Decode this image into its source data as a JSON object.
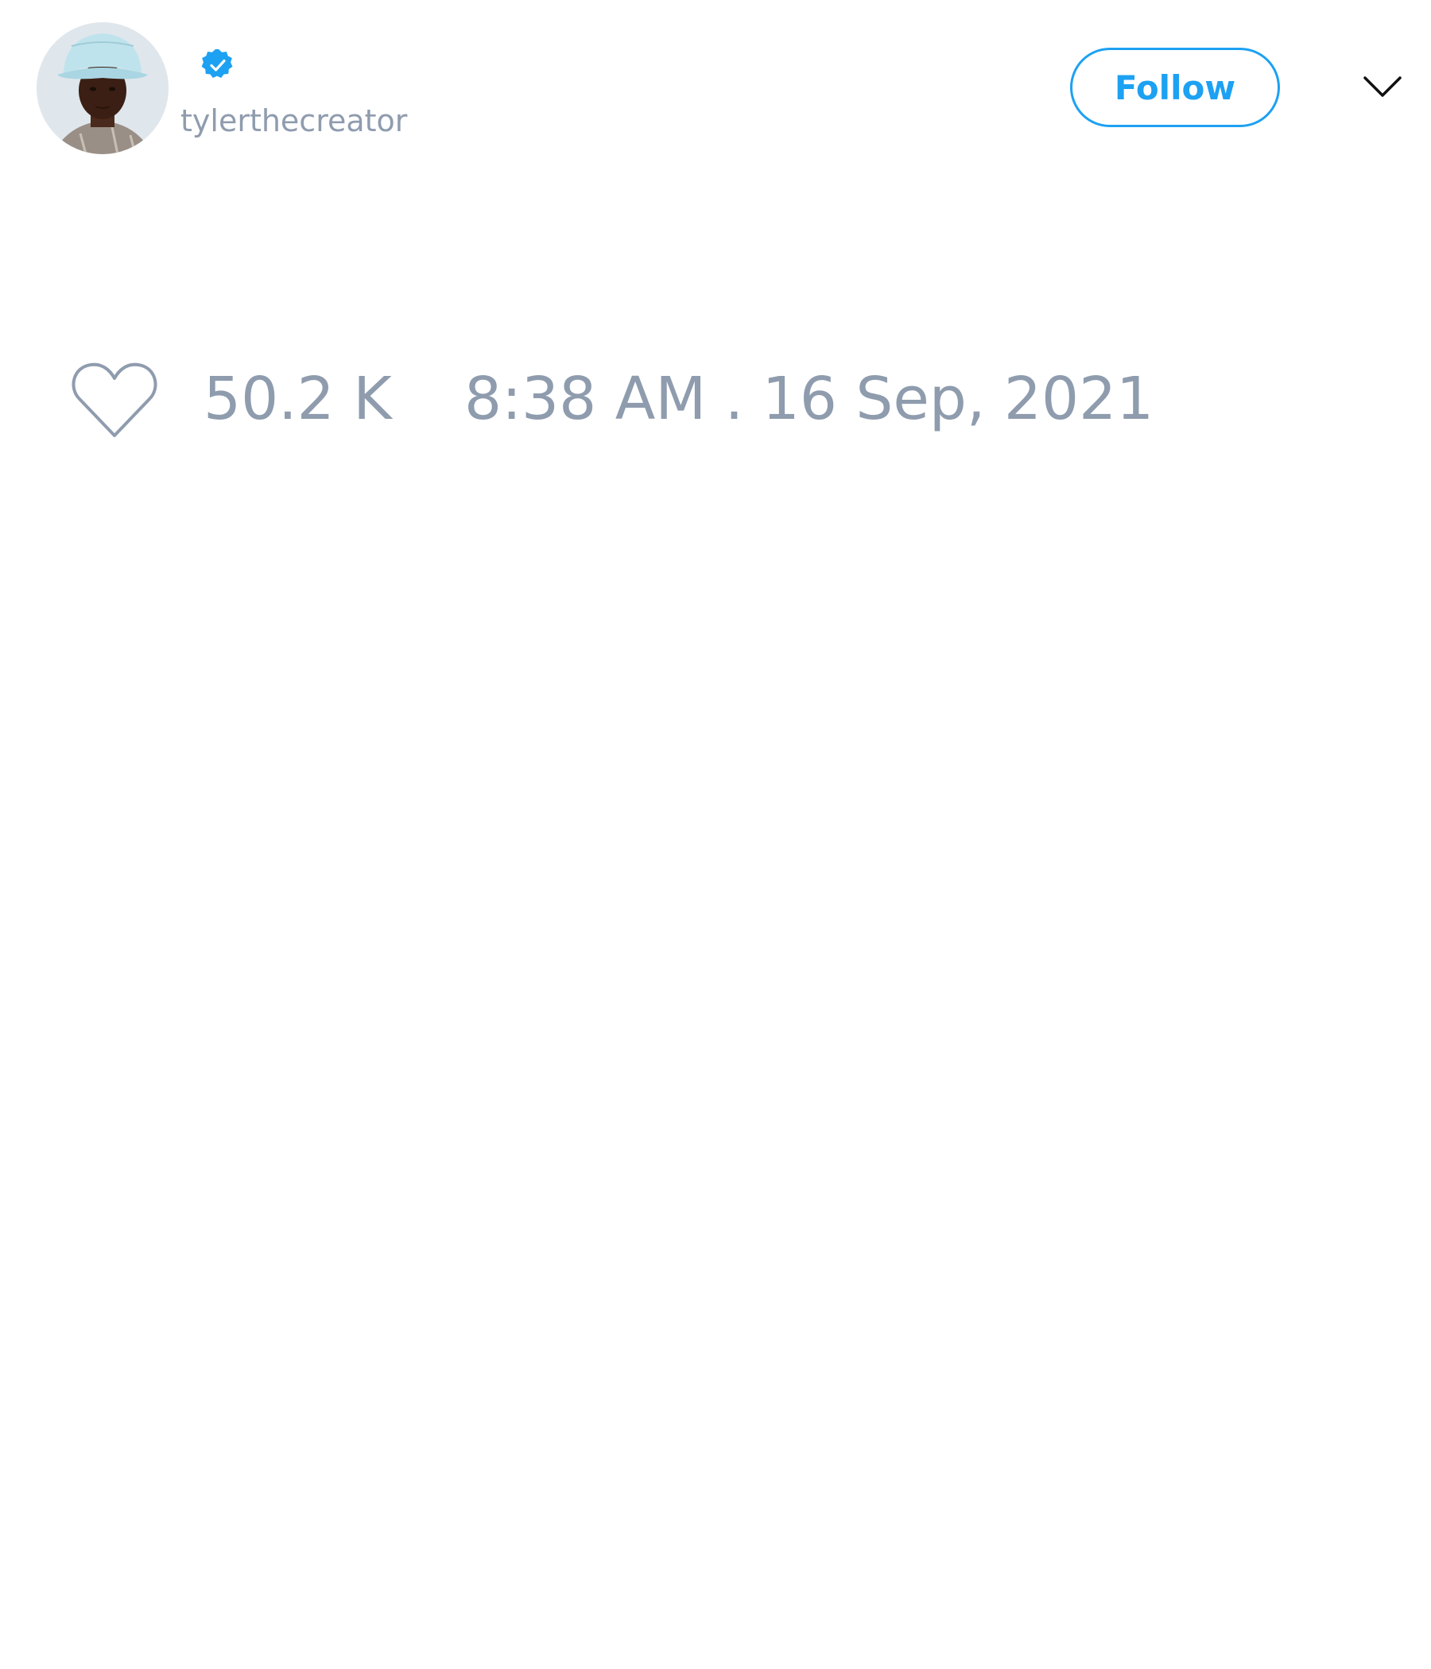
{
  "tweet": {
    "author": {
      "handle": "tylerthecreator",
      "verified": true,
      "avatar": "profile-photo"
    },
    "follow_label": "Follow",
    "menu_icon": "chevron-down-icon",
    "likes": {
      "icon": "heart-icon",
      "count": "50.2 K"
    },
    "timestamp": "8:38 AM . 16 Sep, 2021"
  },
  "colors": {
    "accent": "#1da1f2",
    "muted_text": "#8f9cae",
    "background": "#ffffff"
  }
}
